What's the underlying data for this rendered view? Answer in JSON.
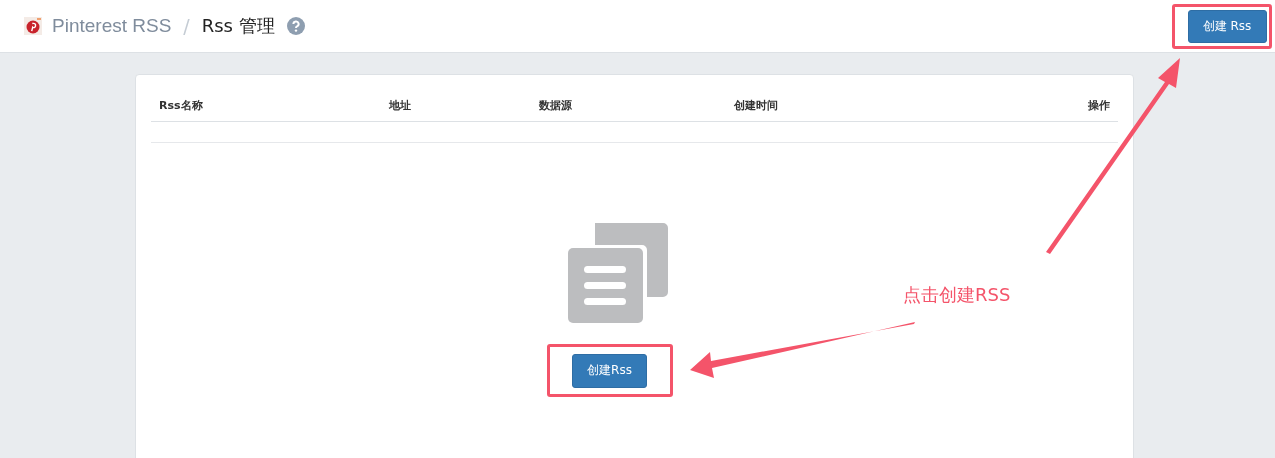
{
  "header": {
    "app_name": "Pinterest RSS",
    "separator": "/",
    "page_title": "Rss 管理",
    "create_button": "创建 Rss"
  },
  "table": {
    "columns": [
      "Rss名称",
      "地址",
      "数据源",
      "创建时间",
      "操作"
    ]
  },
  "empty_state": {
    "create_button": "创建Rss"
  },
  "annotation": {
    "text": "点击创建RSS"
  }
}
